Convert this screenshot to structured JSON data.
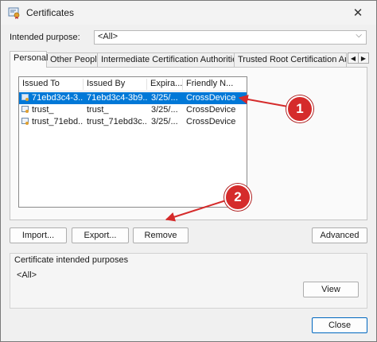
{
  "window": {
    "title": "Certificates",
    "close_glyph": "✕"
  },
  "purpose": {
    "label": "Intended purpose:",
    "value": "<All>"
  },
  "tabs": [
    {
      "label": "Personal"
    },
    {
      "label": "Other People"
    },
    {
      "label": "Intermediate Certification Authorities"
    },
    {
      "label": "Trusted Root Certification Authorities"
    }
  ],
  "list": {
    "columns": [
      "Issued To",
      "Issued By",
      "Expira...",
      "Friendly N..."
    ],
    "rows": [
      {
        "issued_to": "71ebd3c4-3...",
        "issued_by": "71ebd3c4-3b9...",
        "expiration": "3/25/...",
        "friendly": "CrossDevice",
        "selected": true
      },
      {
        "issued_to": "trust_",
        "issued_by": "trust_",
        "expiration": "3/25/...",
        "friendly": "CrossDevice",
        "selected": false
      },
      {
        "issued_to": "trust_71ebd...",
        "issued_by": "trust_71ebd3c...",
        "expiration": "3/25/...",
        "friendly": "CrossDevice",
        "selected": false
      }
    ]
  },
  "buttons": {
    "import": "Import...",
    "export": "Export...",
    "remove": "Remove",
    "advanced": "Advanced",
    "view": "View",
    "close": "Close"
  },
  "purposes_group": {
    "label": "Certificate intended purposes",
    "value": "<All>"
  },
  "annotations": [
    {
      "label": "1"
    },
    {
      "label": "2"
    }
  ],
  "colors": {
    "selection": "#0078d7",
    "annotation": "#d52b2b"
  }
}
